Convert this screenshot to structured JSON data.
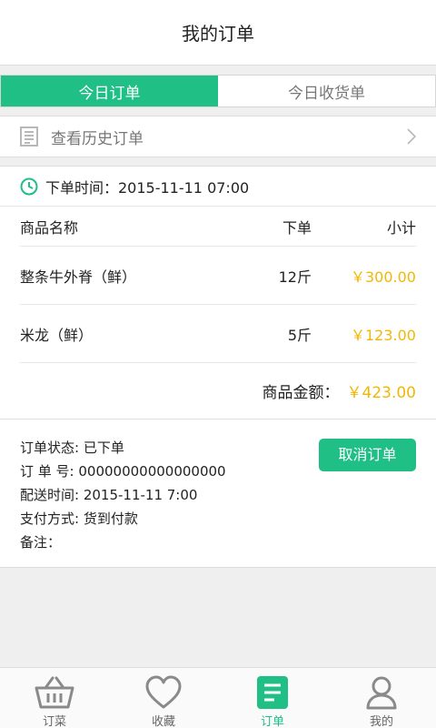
{
  "header": {
    "title": "我的订单"
  },
  "tabs": [
    {
      "label": "今日订单",
      "active": true
    },
    {
      "label": "今日收货单",
      "active": false
    }
  ],
  "history": {
    "icon": "document-icon",
    "label": "查看历史订单"
  },
  "order": {
    "time_label": "下单时间：2015-11-11  07:00",
    "columns": {
      "name": "商品名称",
      "qty": "下单",
      "subtotal": "小计"
    },
    "items": [
      {
        "name": "整条牛外脊（鲜）",
        "qty": "12斤",
        "subtotal": "￥300.00"
      },
      {
        "name": "米龙（鲜）",
        "qty": "5斤",
        "subtotal": "￥123.00"
      }
    ],
    "total_label": "商品金额：",
    "total_value": "￥423.00",
    "info": {
      "status": "订单状态: 已下单",
      "number": "订  单  号: 00000000000000000",
      "delivery": "配送时间: 2015-11-11 7:00",
      "payment": "支付方式: 货到付款",
      "note": "备注："
    },
    "cancel_label": "取消订单"
  },
  "tabbar": [
    {
      "label": "订菜",
      "icon": "basket-icon"
    },
    {
      "label": "收藏",
      "icon": "heart-icon"
    },
    {
      "label": "订单",
      "icon": "order-list-icon",
      "active": true
    },
    {
      "label": "我的",
      "icon": "user-icon"
    }
  ],
  "colors": {
    "accent": "#1fbf86",
    "price": "#f2b705"
  }
}
